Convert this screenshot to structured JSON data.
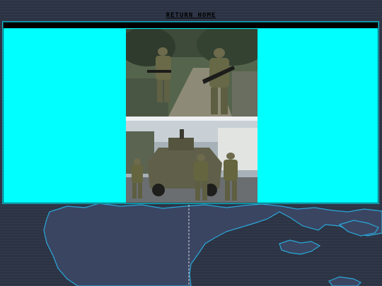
{
  "nav": {
    "return_home_label": "RETURN HOME"
  },
  "photos": [
    {
      "name": "soldiers-patrol-photo"
    },
    {
      "name": "armored-vehicle-photo"
    }
  ],
  "colors": {
    "window_bg": "#00ffff",
    "map_bg": "#2c3344",
    "coastline": "#2aa7d8"
  }
}
